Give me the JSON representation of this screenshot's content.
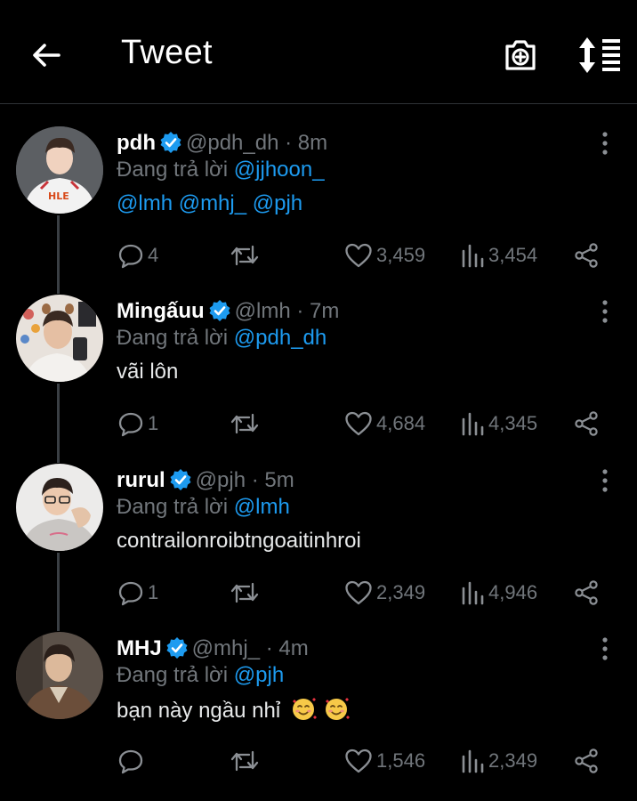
{
  "header": {
    "title": "Tweet",
    "back_icon": "arrow-left-icon",
    "camera_icon": "camera-add-icon",
    "sort_icon": "sort-icon"
  },
  "colors": {
    "background": "#000000",
    "link": "#1d9bf0",
    "muted": "#71767b",
    "text": "#e7e9ea",
    "verified": "#1d9bf0"
  },
  "reply_prefix": "Đang trả lời",
  "tweets": [
    {
      "name": "pdh",
      "handle": "@pdh_dh",
      "dot": "·",
      "time": "8m",
      "replying_to": "@jjhoon_",
      "body_links": "@lmh @mhj_ @pjh",
      "body": "",
      "replies": "4",
      "retweets": "",
      "likes": "3,459",
      "views": "3,454"
    },
    {
      "name": "Mingấuu",
      "handle": "@lmh",
      "dot": "·",
      "time": "7m",
      "replying_to": "@pdh_dh",
      "body_links": "",
      "body": "vãi lôn",
      "replies": "1",
      "retweets": "",
      "likes": "4,684",
      "views": "4,345"
    },
    {
      "name": "rurul",
      "handle": "@pjh",
      "dot": "·",
      "time": "5m",
      "replying_to": "@lmh",
      "body_links": "",
      "body": "contrailonroibtngoaitinhroi",
      "replies": "1",
      "retweets": "",
      "likes": "2,349",
      "views": "4,946"
    },
    {
      "name": "MHJ",
      "handle": "@mhj_",
      "dot": "·",
      "time": "4m",
      "replying_to": "@pjh",
      "body_links": "",
      "body": "bạn này ngầu nhỉ",
      "body_emoji": "🥰🥰",
      "replies": "",
      "retweets": "",
      "likes": "1,546",
      "views": "2,349"
    }
  ]
}
